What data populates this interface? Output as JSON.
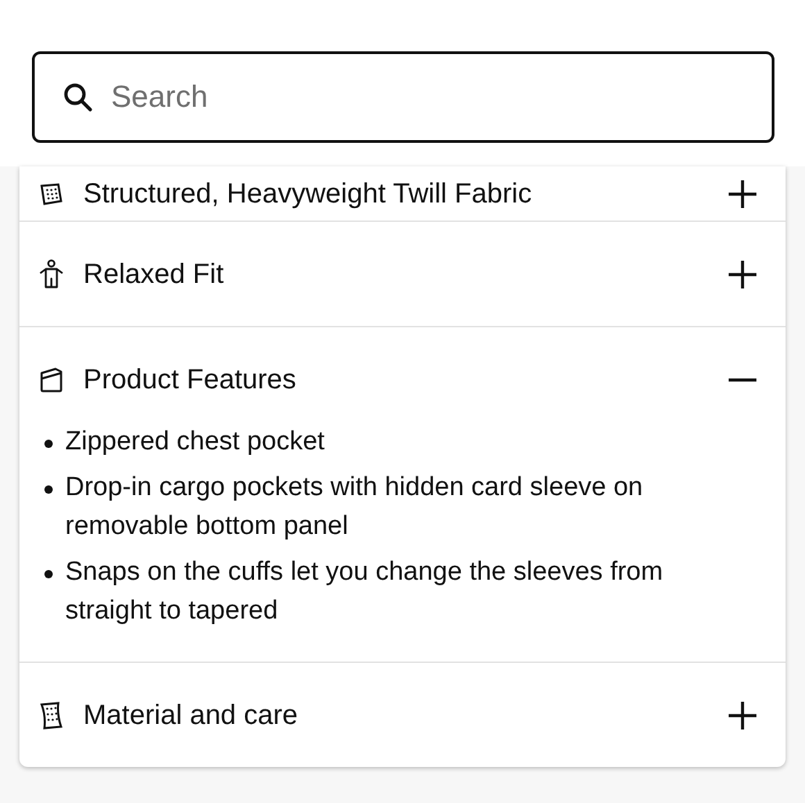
{
  "search": {
    "placeholder": "Search"
  },
  "sections": [
    {
      "title": "Structured, Heavyweight Twill Fabric",
      "expanded": false
    },
    {
      "title": "Relaxed Fit",
      "expanded": false
    },
    {
      "title": "Product Features",
      "expanded": true,
      "bullets": [
        "Zippered chest pocket",
        "Drop-in cargo pockets with hidden card sleeve on removable bottom panel",
        "Snaps on the cuffs let you change the sleeves from straight to tapered"
      ]
    },
    {
      "title": "Material and care",
      "expanded": false
    }
  ]
}
